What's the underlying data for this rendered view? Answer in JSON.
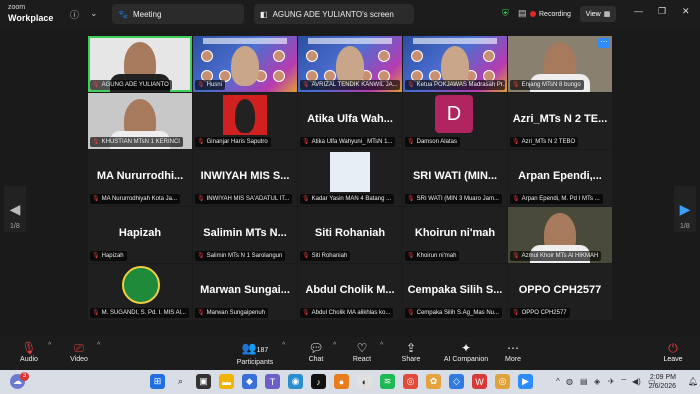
{
  "app": {
    "logo_line1": "zoom",
    "logo_line2": "Workplace"
  },
  "topbar": {
    "meeting_tab": "Meeting",
    "screen_tab": "AGUNG ADE YULIANTO's screen",
    "recording": "Recording",
    "view": "View"
  },
  "tiles": [
    {
      "kind": "video",
      "label": "AGUNG ADE YULIANTO",
      "active": true
    },
    {
      "kind": "poster",
      "label": "Husni"
    },
    {
      "kind": "poster",
      "label": "AVRIZAL TENDIK KANWIL JA..."
    },
    {
      "kind": "poster",
      "label": "Ketua POKJAWAS Madrasah Pr..."
    },
    {
      "kind": "video",
      "label": "Enjang MTsN 8 bungo"
    },
    {
      "kind": "video",
      "label": "KHUSTIAN MTsN 1 KERINCI"
    },
    {
      "kind": "photo",
      "label": "Ginanjar Haris Saputro"
    },
    {
      "kind": "name",
      "name": "Atika Ulfa Wah...",
      "label": "Atika Ulfa Wahyuni_ MTsN 1..."
    },
    {
      "kind": "avatar",
      "initial": "D",
      "label": "Damson Alatas"
    },
    {
      "kind": "name",
      "name": "Azri_MTs N 2 TE...",
      "label": "Azri_MTs N 2 TEBO"
    },
    {
      "kind": "name",
      "name": "MA Nururrodhi...",
      "label": "MA Nururrodhiyah Kota Ja..."
    },
    {
      "kind": "name",
      "name": "INWIYAH MIS S...",
      "label": "INWIYAH MIS SA'ADATUL IT..."
    },
    {
      "kind": "doc",
      "label": "Kadar Yasin MAN 4 Batang ..."
    },
    {
      "kind": "name",
      "name": "SRI WATI (MIN...",
      "label": "SRI WATI (MIN 3 Muaro Jam..."
    },
    {
      "kind": "name",
      "name": "Arpan Ependi,...",
      "label": "Arpan Ependi, M. Pd I MTs ..."
    },
    {
      "kind": "name",
      "name": "Hapizah",
      "label": "Hapizah"
    },
    {
      "kind": "name",
      "name": "Salimin MTs N...",
      "label": "Salimin MTs N 1 Sarolangun"
    },
    {
      "kind": "name",
      "name": "Siti Rohaniah",
      "label": "Siti Rohaniah"
    },
    {
      "kind": "name",
      "name": "Khoirun ni'mah",
      "label": "Khoirun ni'mah"
    },
    {
      "kind": "video",
      "label": "Azmul Khoir MTs Al HIKMAH"
    },
    {
      "kind": "emblem",
      "label": "M. SUGANDI, S. Pd. I. MIS Al..."
    },
    {
      "kind": "name",
      "name": "Marwan Sungai...",
      "label": "Marwan Sungaipenuh"
    },
    {
      "kind": "name",
      "name": "Abdul Cholik M...",
      "label": "Abdul Cholik MA alikhlas ko..."
    },
    {
      "kind": "name",
      "name": "Cempaka Silih S...",
      "label": "Cempaka Silih S.Ag_Mas Nu..."
    },
    {
      "kind": "name",
      "name": "OPPO CPH2577",
      "label": "OPPO CPH2577"
    }
  ],
  "pager": {
    "left": "1/8",
    "right": "1/8"
  },
  "toolbar": {
    "audio": "Audio",
    "video": "Video",
    "participants": "Participants",
    "participant_count": "187",
    "chat": "Chat",
    "react": "React",
    "share": "Share",
    "ai_companion": "AI Companion",
    "more": "More",
    "leave": "Leave"
  },
  "taskbar": {
    "time": "2:09 PM",
    "date": "2/6/2026",
    "notification_badge": "3"
  }
}
